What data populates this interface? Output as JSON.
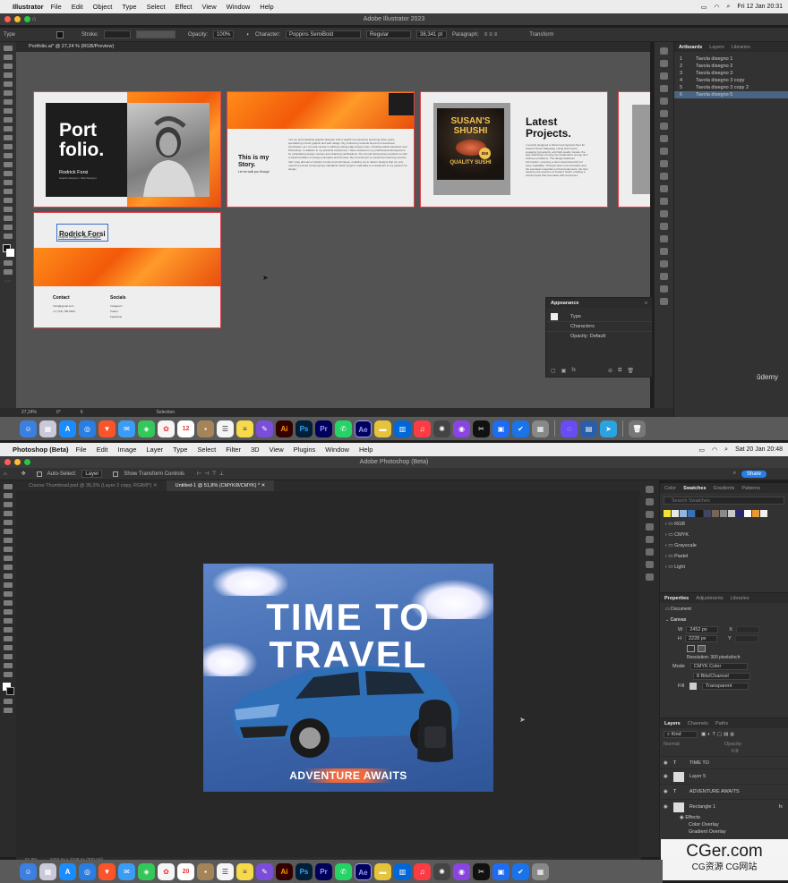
{
  "ai": {
    "menubar": {
      "app": "Illustrator",
      "items": [
        "File",
        "Edit",
        "Object",
        "Type",
        "Select",
        "Effect",
        "View",
        "Window",
        "Help"
      ],
      "clock": "Fri 12 Jan  20:31"
    },
    "title": "Adobe Illustrator 2023",
    "doc_tab": "Portfolio.ai* @ 27,24 % (RGB/Preview)",
    "control": {
      "type": "Type",
      "stroke": "Stroke:",
      "opacity_label": "Opacity:",
      "opacity": "100%",
      "character": "Character:",
      "font": "Poppins SemiBold",
      "style": "Regular",
      "size": "38,341 pt",
      "paragraph": "Paragraph:",
      "transform": "Transform"
    },
    "artboards_panel": {
      "tabs": [
        "Artboards",
        "Layers",
        "Libraries"
      ],
      "items": [
        {
          "n": "1",
          "name": "Tavola disegno 1"
        },
        {
          "n": "2",
          "name": "Tavola disegno 2"
        },
        {
          "n": "3",
          "name": "Tavola disegno 3"
        },
        {
          "n": "4",
          "name": "Tavola disegno 3 copy"
        },
        {
          "n": "5",
          "name": "Tavola disegno 3 copy 2"
        },
        {
          "n": "6",
          "name": "Tavola disegno 5"
        }
      ]
    },
    "appearance": {
      "title": "Appearance",
      "type": "Type",
      "characters": "Characters",
      "opacity": "Opacity:",
      "opacity_val": "Default"
    },
    "zoom": "27,24%",
    "angle": "0°",
    "page": "6",
    "status": "Selection",
    "udemy": "ûdemy",
    "art1": {
      "title": "Port\nfolio.",
      "name": "Rodrick Forsi",
      "sub": "Graphic Designer / Web Designer"
    },
    "art2": {
      "title": "This is my\nStory.",
      "sub": "Let me walk you through",
      "body": "I am an accomplished graphic designer with a wealth of experience spanning three years, specializing in both graphic and web design. My proficiency extends beyond conventional boundaries, as I am well-versed in utilizing cutting-edge design tools, including Adobe Illustrator and Photoshop. In addition to my practical experience, I have invested in my professional development by undertaking design courses and obtaining certifications. The formal training has provided me with a solid foundation in design principles and theories. My commitment to continuous learning ensures that I stay abreast of industry trends and techniques, enabling me to deliver designs that not only meet but exceed contemporary standards. Each project I undertake is a testament to my passion for design."
    },
    "art3": {
      "title": "Latest\nProjects.",
      "poster_title": "SUSAN'S",
      "poster_title2": "SHUSHI",
      "poster_bottom": "QUALITY SUSHI",
      "price": "$50",
      "body": "I recently designed a vibrant and dynamic flyer for Susan's Sushi Takeaway. Using bold colors, engaging typography, and high-quality visuals, the flyer effectively conveys the restaurant's energy and culinary excellence. The design balances information, ensuring a clear visual hierarchy for easy readability. Through clear communication and the seamless integration of brand elements, the flyer captures the essence of Susan's Sushi, creating a visual impact that resonates with customers."
    },
    "art5": {
      "name": "Rodrick Forsi",
      "sub": "Graphic Designer / Web Designer",
      "contact": "Contact",
      "contact_lines": [
        "rforsi@gmail.com",
        "+1 (716) 798-9943"
      ],
      "socials": "Socials",
      "social_lines": [
        "Instagram",
        "Twitter",
        "Facebook"
      ]
    }
  },
  "ps": {
    "menubar": {
      "app": "Photoshop (Beta)",
      "items": [
        "File",
        "Edit",
        "Image",
        "Layer",
        "Type",
        "Select",
        "Filter",
        "3D",
        "View",
        "Plugins",
        "Window",
        "Help"
      ],
      "clock": "Sat 20 Jan  20:48"
    },
    "title": "Adobe Photoshop (Beta)",
    "options": {
      "auto_select": "Auto-Select:",
      "layer": "Layer",
      "transform": "Show Transform Controls",
      "share": "Share"
    },
    "tabs": [
      "Course Thumbnail.psd @ 35,3% (Layer 2 copy, RGB/8*)",
      "Untitled-1 @ 51,8% (CMYK/8/CMYK) *"
    ],
    "canvas": {
      "line1": "TIME TO",
      "line2": "TRAVEL",
      "banner": "ADVENTURE AWAITS"
    },
    "swatches": {
      "tabs": [
        "Color",
        "Swatches",
        "Gradients",
        "Patterns"
      ],
      "search": "Search Swatches",
      "groups": [
        "RGB",
        "CMYK",
        "Grayscale",
        "Pastel",
        "Light"
      ],
      "colors": [
        "#f5e132",
        "#e8e8e8",
        "#8fb7e0",
        "#3a6fb8",
        "#1c1c1c",
        "#444466",
        "#776655",
        "#8a8a8a",
        "#c8c8c8",
        "#2a2a6a",
        "#ffffff",
        "#e89a30",
        "#f0f0f0"
      ]
    },
    "properties": {
      "tabs": [
        "Properties",
        "Adjustments",
        "Libraries"
      ],
      "doc": "Document",
      "canvas": "Canvas",
      "w_label": "W",
      "w": "2452 px",
      "h_label": "H",
      "h": "2228 px",
      "x": "X",
      "y": "Y",
      "resolution": "Resolution: 300 pixels/inch",
      "mode_label": "Mode",
      "mode": "CMYK Color",
      "depth": "8 Bits/Channel",
      "fill_label": "Fill",
      "fill": "Transparent"
    },
    "layers": {
      "tabs": [
        "Layers",
        "Channels",
        "Paths"
      ],
      "kind": "Kind",
      "normal": "Normal",
      "opacity": "Opacity:",
      "fill": "Fill:",
      "items": [
        "TIME TO",
        "Layer 5",
        "ADVENTURE AWAITS",
        "Rectangle 1"
      ],
      "effects": "Effects",
      "fx1": "Color Overlay",
      "fx2": "Gradient Overlay"
    },
    "status": {
      "zoom": "51,8%",
      "size": "2452 px x 2228 px (300 ppi)"
    },
    "watermark1": "CGer.com",
    "watermark2": "CG资源  CG网站"
  },
  "dock": {
    "badge": "12",
    "cal": "20"
  }
}
